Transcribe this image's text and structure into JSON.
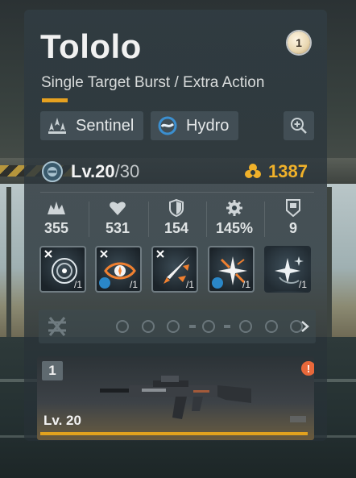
{
  "character": {
    "name": "Tololo",
    "rank_badge": "1",
    "roles": "Single Target Burst / Extra Action",
    "class_chip": {
      "label": "Sentinel",
      "icon": "sentinel-icon"
    },
    "element_chip": {
      "label": "Hydro",
      "icon": "hydro-icon"
    },
    "level_label": "Lv.20",
    "level_max": "/30",
    "power": "1387"
  },
  "stats": [
    {
      "icon": "attack-icon",
      "value": "355"
    },
    {
      "icon": "health-icon",
      "value": "531"
    },
    {
      "icon": "defense-icon",
      "value": "154"
    },
    {
      "icon": "crit-gear-icon",
      "value": "145%"
    },
    {
      "icon": "shield-badge-icon",
      "value": "9"
    }
  ],
  "skills": [
    {
      "icon": "target-skill-icon",
      "count": "/1"
    },
    {
      "icon": "eye-skill-icon",
      "count": "/1"
    },
    {
      "icon": "slash-skill-icon",
      "count": "/1"
    },
    {
      "icon": "burst-star-skill-icon",
      "count": "/1"
    },
    {
      "icon": "sparkle-skill-icon",
      "count": "/1"
    }
  ],
  "weapon": {
    "tier": "1",
    "level_label": "Lv. 20",
    "alert": "!"
  },
  "colors": {
    "accent": "#e6a120",
    "power": "#f0b12a",
    "hydro": "#2a87c8",
    "alert": "#e8683a"
  }
}
